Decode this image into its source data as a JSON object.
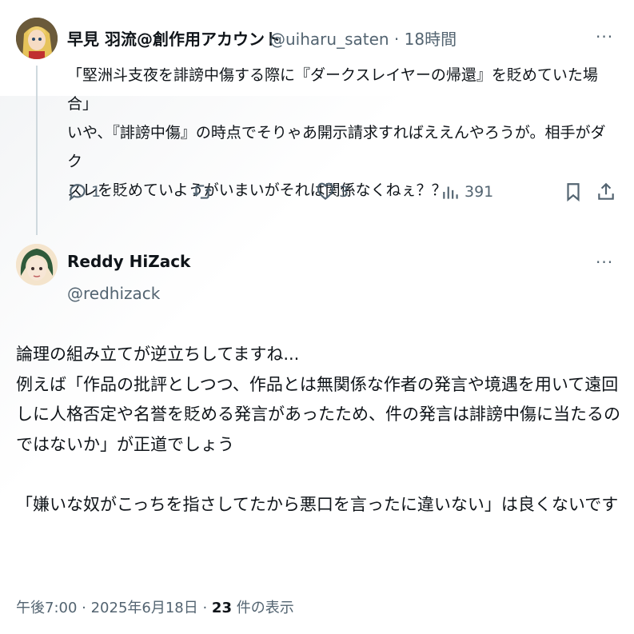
{
  "reply": {
    "name": "早見 羽流@創作用アカウント",
    "handle": "@uiharu_saten",
    "separator": "·",
    "time": "18時間",
    "more": "···",
    "text": "「堅洲斗支夜を誹謗中傷する際に『ダークスレイヤーの帰還』を貶めていた場合」\nいや、『誹謗中傷』の時点でそりゃあ開示請求すればええんやろうが。相手がダク\nスレを貶めていようがいまいがそれは関係なくねぇ？？",
    "actions": {
      "replies": "1",
      "retweets": "",
      "likes": "3",
      "views": "391"
    },
    "icons": [
      "reply-icon",
      "retweet-icon",
      "like-icon",
      "views-icon",
      "bookmark-icon",
      "share-icon"
    ]
  },
  "main": {
    "name": "Reddy HiZack",
    "handle": "@redhizack",
    "more": "···",
    "text": "論理の組み立てが逆立ちしてますね...\n例えば「作品の批評としつつ、作品とは無関係な作者の発言や境遇を用いて遠回\nしに人格否定や名誉を貶める発言があったため、件の発言は誹謗中傷に当たるの\nではないか」が正道でしょう\n\n「嫌いな奴がこっちを指さしてたから悪口を言ったに違いない」は良くないです",
    "timestamp": "午後7:00 · 2025年6月18日 · ",
    "views_count": "23",
    "views_label": " 件の表示"
  },
  "colors": {
    "text": "#0f1419",
    "secondary": "#536471",
    "thread_line": "#cfd9de"
  }
}
